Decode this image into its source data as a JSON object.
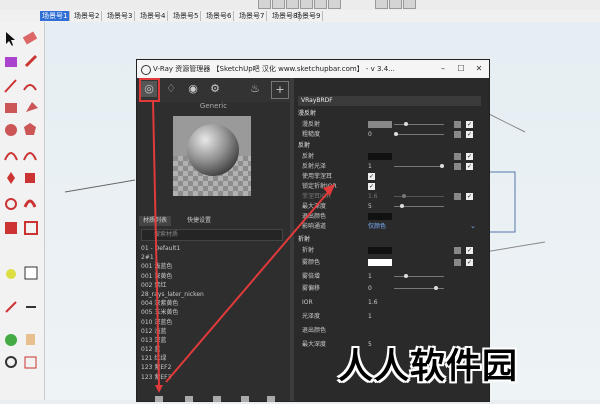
{
  "scene_tabs": [
    "场景号1",
    "场景号2",
    "场景号3",
    "场景号4",
    "场景号5",
    "场景号6",
    "场景号7",
    "场景号8",
    "场景号9"
  ],
  "vray": {
    "title": "V-Ray 资源管理器 【SketchUp吧 汉化 www.sketchupbar.com】 - v 3.4...",
    "preview_label": "Generic",
    "panel_tabs": [
      "材质列表",
      "快捷设置"
    ],
    "search_placeholder": "搜索材质",
    "materials": [
      "01 - Default1",
      "2#1",
      "001 浅蓝色",
      "001 深黄色",
      "002 紫红",
      "28_rays_later_nicken",
      "004 深紫黄色",
      "005 玉米黄色",
      "010 深蓝色",
      "012 浅蓝",
      "013 深蓝",
      "012 蓝",
      "121 红绿",
      "123 紫EF2",
      "123 紫EF3"
    ],
    "props_header": "VRayBRDF",
    "sections": {
      "diffuse": "漫反射",
      "reflection": "反射",
      "refraction": "折射"
    },
    "rows_diffuse": [
      {
        "label": "漫反射"
      },
      {
        "label": "粗糙度",
        "value": "0"
      }
    ],
    "rows_reflection": [
      {
        "label": "反射"
      },
      {
        "label": "反射光泽",
        "value": "1"
      },
      {
        "label": "使用菲涅耳"
      },
      {
        "label": "锁定折射IOR"
      },
      {
        "label": "菲涅耳IOR",
        "value": "1.6"
      },
      {
        "label": "最大深度",
        "value": "5"
      },
      {
        "label": "退出颜色"
      },
      {
        "label": "影响通道",
        "value": "仅颜色"
      }
    ],
    "rows_refraction": [
      {
        "label": "折射"
      },
      {
        "label": "雾颜色"
      },
      {
        "label": "雾倍增",
        "value": "1"
      },
      {
        "label": "雾偏移",
        "value": "0"
      },
      {
        "label": "IOR",
        "value": "1.6"
      },
      {
        "label": "光泽度",
        "value": "1"
      },
      {
        "label": "退出颜色"
      },
      {
        "label": "最大深度",
        "value": "5"
      }
    ]
  },
  "watermark": "人人软件园",
  "colors": {
    "accent": "#2f6fd6",
    "highlight": "#e03a3a",
    "panel": "#3c3c3c"
  }
}
